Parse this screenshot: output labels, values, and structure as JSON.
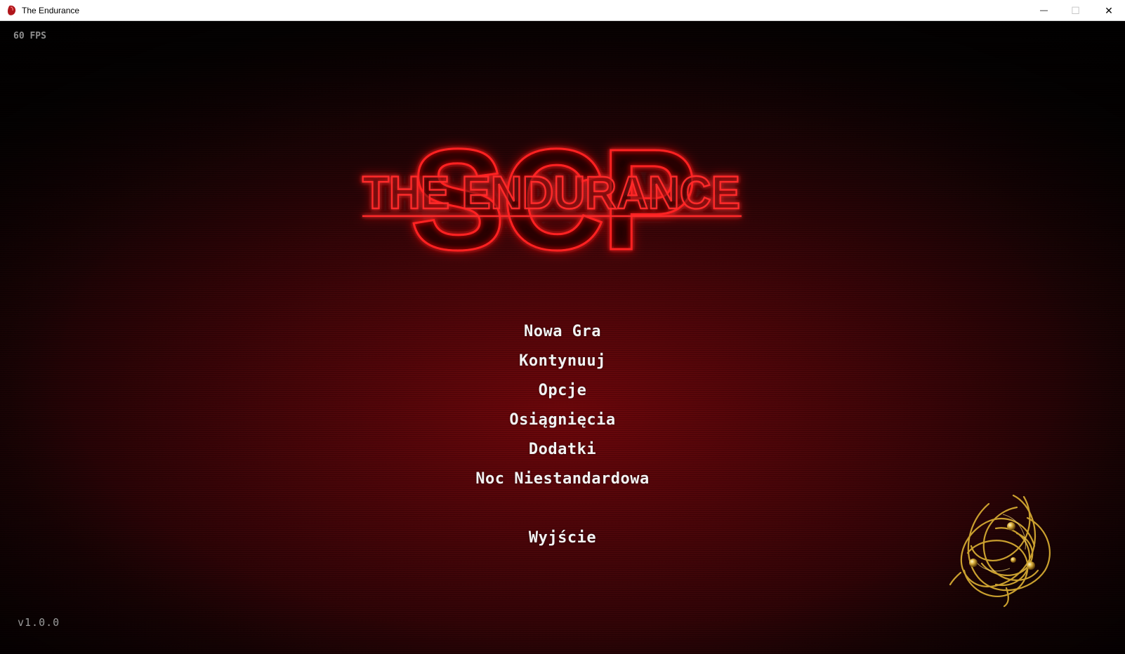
{
  "window": {
    "title": "The Endurance",
    "minimize_glyph": "—",
    "maximize_glyph": "☐",
    "close_glyph": "✕"
  },
  "hud": {
    "fps": "60 FPS",
    "version": "v1.0.0"
  },
  "logo": {
    "big_text": "SCP",
    "sub_text": "THE ENDURANCE",
    "glow_color": "#ff1a1a"
  },
  "menu": {
    "items": [
      {
        "label": "Nowa Gra"
      },
      {
        "label": "Kontynuuj"
      },
      {
        "label": "Opcje"
      },
      {
        "label": "Osiągnięcia"
      },
      {
        "label": "Dodatki"
      },
      {
        "label": "Noc Niestandardowa"
      },
      {
        "label": "Wyjście"
      }
    ]
  },
  "colors": {
    "background_red": "#78060a",
    "menu_text": "#f2f2f2",
    "mascot_gold": "#d4a932"
  },
  "icons": {
    "app": "red-bean-icon",
    "mascot": "gold-wire-ball-icon"
  }
}
